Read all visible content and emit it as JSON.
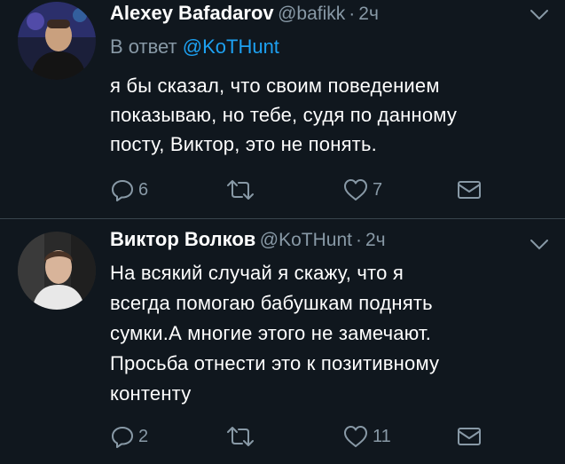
{
  "tweets": [
    {
      "author_name": "Alexey Bafadarov",
      "handle": "@bafikk",
      "separator": "·",
      "time": "2ч",
      "reply_prefix": "В ответ",
      "reply_mention": "@KoTHunt",
      "text_lines": [
        "я бы сказал, что своим поведением",
        "показываю, но тебе, судя по данному",
        "посту, Виктор, это не понять."
      ],
      "reply_count": "6",
      "retweet_count": "",
      "like_count": "7"
    },
    {
      "author_name": "Виктор Волков",
      "handle": "@KoTHunt",
      "separator": "·",
      "time": "2ч",
      "text_lines": [
        "На всякий случай я скажу, что я",
        "всегда помогаю бабушкам поднять",
        "сумки.А многие этого не замечают.",
        "Просьба отнести это к позитивному",
        "контенту"
      ],
      "reply_count": "2",
      "retweet_count": "",
      "like_count": "11"
    }
  ],
  "icons": {
    "reply": "reply-icon",
    "retweet": "retweet-icon",
    "like": "heart-icon",
    "dm": "envelope-icon",
    "caret": "chevron-down-icon"
  },
  "colors": {
    "background": "#10171e",
    "text": "#ffffff",
    "secondary": "#8899a6",
    "link": "#1da1f2"
  }
}
